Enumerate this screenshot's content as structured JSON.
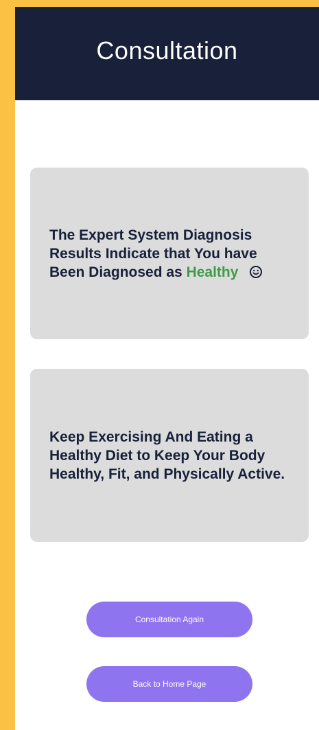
{
  "header": {
    "title": "Consultation"
  },
  "result_card": {
    "line1": "The Expert System Diagnosis Results Indicate that You have Been Diagnosed as",
    "diagnosis": "Healthy",
    "diagnosis_icon": "smile-icon"
  },
  "advice_card": {
    "text": "Keep Exercising And Eating a Healthy Diet to Keep Your Body Healthy, Fit, and Physically Active."
  },
  "actions": {
    "consult_again_label": "Consultation Again",
    "back_home_label": "Back to Home Page"
  },
  "colors": {
    "accent_yellow": "#FBC144",
    "header_navy": "#18203A",
    "card_gray": "#DCDCDC",
    "healthy_green": "#3E9C48",
    "button_purple": "#8F74F0"
  }
}
